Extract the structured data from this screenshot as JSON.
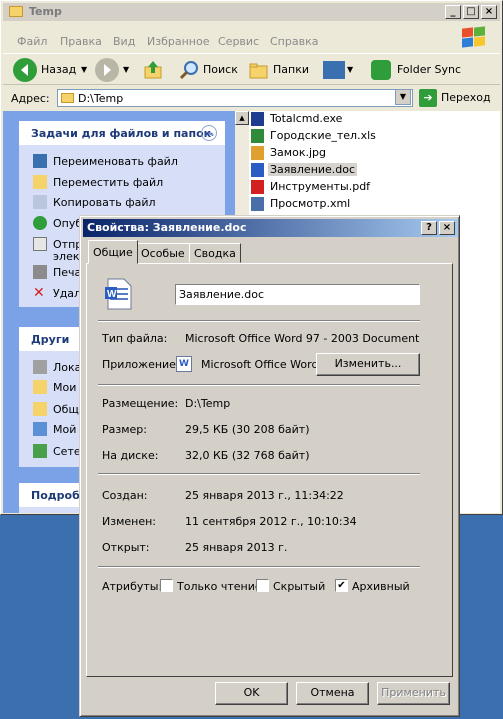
{
  "explorer": {
    "title": "Temp",
    "menu": [
      "Файл",
      "Правка",
      "Вид",
      "Избранное",
      "Сервис",
      "Справка"
    ],
    "toolbar": {
      "back": "Назад",
      "search": "Поиск",
      "folders": "Папки",
      "sync": "Folder Sync"
    },
    "address": {
      "label": "Адрес:",
      "value": "D:\\Temp",
      "go": "Переход"
    },
    "tasks": {
      "title": "Задачи для файлов и папок",
      "items": [
        "Переименовать файл",
        "Переместить файл",
        "Копировать файл",
        "Опуб",
        "Отпр",
        "элек",
        "Печа",
        "Удал"
      ]
    },
    "other": {
      "title": "Други",
      "items": [
        "Лока",
        "Мои",
        "Общ",
        "Мой",
        "Сете"
      ]
    },
    "details": {
      "title": "Подроб"
    },
    "files": [
      "Totalcmd.exe",
      "Городские_тел.xls",
      "Замок.jpg",
      "Заявление.doc",
      "Инструменты.pdf",
      "Просмотр.xml"
    ]
  },
  "dialog": {
    "title": "Свойства: Заявление.doc",
    "tabs": [
      "Общие",
      "Особые",
      "Сводка"
    ],
    "filename": "Заявление.doc",
    "type_label": "Тип файла:",
    "type_value": "Microsoft Office Word 97 - 2003 Document",
    "app_label": "Приложение:",
    "app_value": "Microsoft Office Word",
    "change": "Изменить...",
    "location_label": "Размещение:",
    "location_value": "D:\\Temp",
    "size_label": "Размер:",
    "size_value": "29,5 КБ (30 208 байт)",
    "disk_label": "На диске:",
    "disk_value": "32,0 КБ (32 768 байт)",
    "created_label": "Создан:",
    "created_value": "25 января 2013 г., 11:34:22",
    "modified_label": "Изменен:",
    "modified_value": "11 сентября 2012 г., 10:10:34",
    "opened_label": "Открыт:",
    "opened_value": "25 января 2013 г.",
    "attrs_label": "Атрибуты:",
    "readonly": "Только чтение",
    "hidden": "Скрытый",
    "archive": "Архивный",
    "archive_checked": true,
    "ok": "OK",
    "cancel": "Отмена",
    "apply": "Применить"
  }
}
